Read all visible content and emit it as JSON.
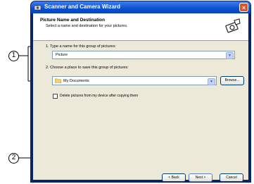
{
  "window": {
    "title": "Scanner and Camera Wizard",
    "close_glyph": "×"
  },
  "header": {
    "title": "Picture Name and Destination",
    "subtitle": "Select a name and destination for your pictures."
  },
  "step1": {
    "label": "1.  Type a name for this group of pictures:",
    "value": "Picture"
  },
  "step2": {
    "label": "2.  Choose a place to save this group of pictures:",
    "value": "My Documents",
    "browse_label": "Browse..."
  },
  "checkbox": {
    "label": "Delete pictures from my device after copying them",
    "checked": false
  },
  "footer": {
    "back_label": "< Back",
    "next_label": "Next >",
    "cancel_label": "Cancel"
  },
  "callouts": {
    "one": "1",
    "two": "2"
  },
  "icons": {
    "title_icon": "camera-icon",
    "wizard_icon": "scanner-camera-icon",
    "folder_icon": "folder-icon",
    "dropdown_icon": "chevron-down-icon"
  },
  "colors": {
    "titlebar": "#0a4fd1",
    "dialog_bg": "#ece9d8",
    "accent_border": "#003c74"
  }
}
